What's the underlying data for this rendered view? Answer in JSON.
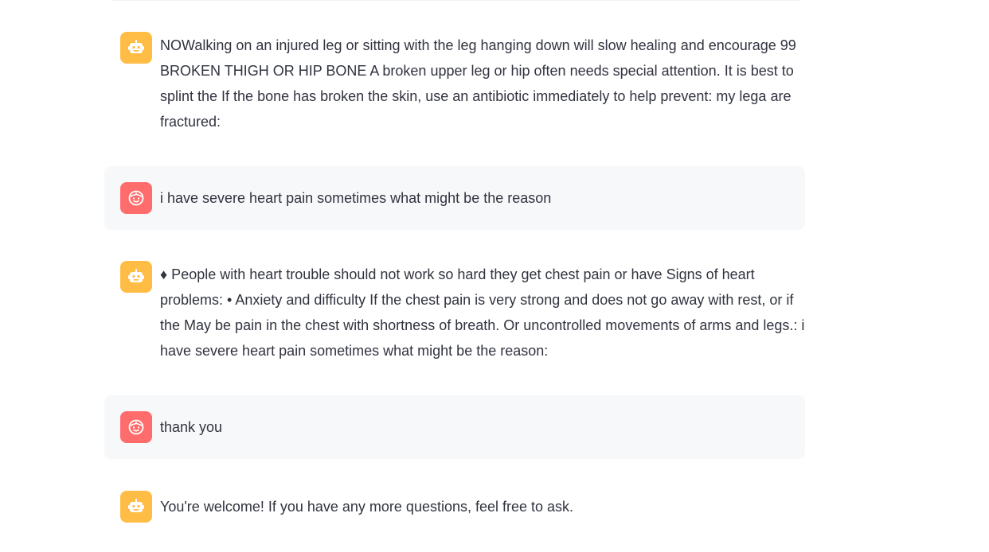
{
  "messages": [
    {
      "role": "assistant",
      "avatar_icon": "robot-face-icon",
      "text": "NOWalking on an injured leg or sitting with the leg hanging down will slow healing and encourage 99 BROKEN THIGH OR HIP BONE A broken upper leg or hip often needs special attention. It is best to splint the If the bone has broken the skin, use an antibiotic immediately to help prevent: my lega are fractured:"
    },
    {
      "role": "user",
      "avatar_icon": "smiley-face-icon",
      "text": "i have severe heart pain sometimes what might be the reason"
    },
    {
      "role": "assistant",
      "avatar_icon": "robot-face-icon",
      "text": "♦ People with heart trouble should not work so hard they get chest pain or have Signs of heart problems: • Anxiety and difficulty If the chest pain is very strong and does not go away with rest, or if the May be pain in the chest with shortness of breath. Or uncontrolled movements of arms and legs.: i have severe heart pain sometimes what might be the reason:"
    },
    {
      "role": "user",
      "avatar_icon": "smiley-face-icon",
      "text": "thank you"
    },
    {
      "role": "assistant",
      "avatar_icon": "robot-face-icon",
      "text": "You're welcome! If you have any more questions, feel free to ask."
    }
  ],
  "colors": {
    "assistant_avatar": "#ffbd45",
    "user_avatar": "#ff6c6c",
    "user_bubble": "#f7f8fa",
    "text": "#31333f"
  }
}
